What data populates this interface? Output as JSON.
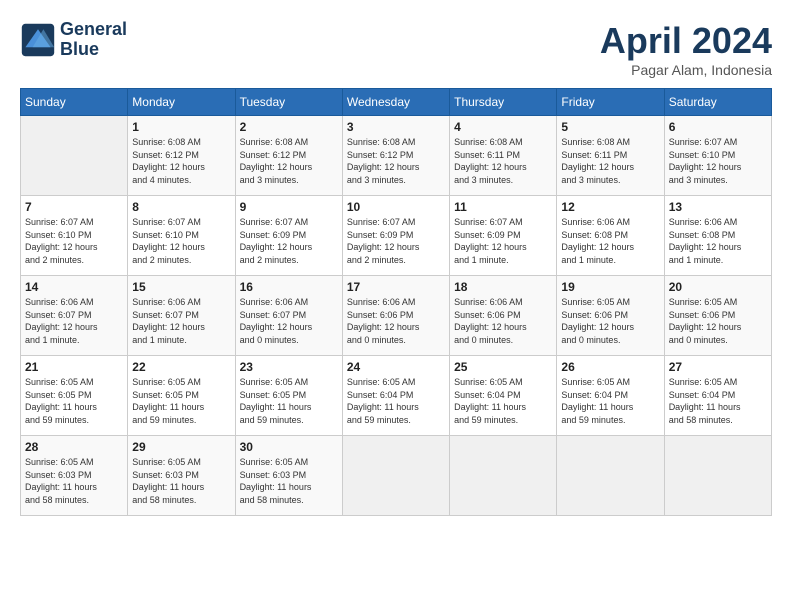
{
  "header": {
    "logo_line1": "General",
    "logo_line2": "Blue",
    "title": "April 2024",
    "location": "Pagar Alam, Indonesia"
  },
  "columns": [
    "Sunday",
    "Monday",
    "Tuesday",
    "Wednesday",
    "Thursday",
    "Friday",
    "Saturday"
  ],
  "weeks": [
    [
      {
        "day": "",
        "info": ""
      },
      {
        "day": "1",
        "info": "Sunrise: 6:08 AM\nSunset: 6:12 PM\nDaylight: 12 hours\nand 4 minutes."
      },
      {
        "day": "2",
        "info": "Sunrise: 6:08 AM\nSunset: 6:12 PM\nDaylight: 12 hours\nand 3 minutes."
      },
      {
        "day": "3",
        "info": "Sunrise: 6:08 AM\nSunset: 6:12 PM\nDaylight: 12 hours\nand 3 minutes."
      },
      {
        "day": "4",
        "info": "Sunrise: 6:08 AM\nSunset: 6:11 PM\nDaylight: 12 hours\nand 3 minutes."
      },
      {
        "day": "5",
        "info": "Sunrise: 6:08 AM\nSunset: 6:11 PM\nDaylight: 12 hours\nand 3 minutes."
      },
      {
        "day": "6",
        "info": "Sunrise: 6:07 AM\nSunset: 6:10 PM\nDaylight: 12 hours\nand 3 minutes."
      }
    ],
    [
      {
        "day": "7",
        "info": "Sunrise: 6:07 AM\nSunset: 6:10 PM\nDaylight: 12 hours\nand 2 minutes."
      },
      {
        "day": "8",
        "info": "Sunrise: 6:07 AM\nSunset: 6:10 PM\nDaylight: 12 hours\nand 2 minutes."
      },
      {
        "day": "9",
        "info": "Sunrise: 6:07 AM\nSunset: 6:09 PM\nDaylight: 12 hours\nand 2 minutes."
      },
      {
        "day": "10",
        "info": "Sunrise: 6:07 AM\nSunset: 6:09 PM\nDaylight: 12 hours\nand 2 minutes."
      },
      {
        "day": "11",
        "info": "Sunrise: 6:07 AM\nSunset: 6:09 PM\nDaylight: 12 hours\nand 1 minute."
      },
      {
        "day": "12",
        "info": "Sunrise: 6:06 AM\nSunset: 6:08 PM\nDaylight: 12 hours\nand 1 minute."
      },
      {
        "day": "13",
        "info": "Sunrise: 6:06 AM\nSunset: 6:08 PM\nDaylight: 12 hours\nand 1 minute."
      }
    ],
    [
      {
        "day": "14",
        "info": "Sunrise: 6:06 AM\nSunset: 6:07 PM\nDaylight: 12 hours\nand 1 minute."
      },
      {
        "day": "15",
        "info": "Sunrise: 6:06 AM\nSunset: 6:07 PM\nDaylight: 12 hours\nand 1 minute."
      },
      {
        "day": "16",
        "info": "Sunrise: 6:06 AM\nSunset: 6:07 PM\nDaylight: 12 hours\nand 0 minutes."
      },
      {
        "day": "17",
        "info": "Sunrise: 6:06 AM\nSunset: 6:06 PM\nDaylight: 12 hours\nand 0 minutes."
      },
      {
        "day": "18",
        "info": "Sunrise: 6:06 AM\nSunset: 6:06 PM\nDaylight: 12 hours\nand 0 minutes."
      },
      {
        "day": "19",
        "info": "Sunrise: 6:05 AM\nSunset: 6:06 PM\nDaylight: 12 hours\nand 0 minutes."
      },
      {
        "day": "20",
        "info": "Sunrise: 6:05 AM\nSunset: 6:06 PM\nDaylight: 12 hours\nand 0 minutes."
      }
    ],
    [
      {
        "day": "21",
        "info": "Sunrise: 6:05 AM\nSunset: 6:05 PM\nDaylight: 11 hours\nand 59 minutes."
      },
      {
        "day": "22",
        "info": "Sunrise: 6:05 AM\nSunset: 6:05 PM\nDaylight: 11 hours\nand 59 minutes."
      },
      {
        "day": "23",
        "info": "Sunrise: 6:05 AM\nSunset: 6:05 PM\nDaylight: 11 hours\nand 59 minutes."
      },
      {
        "day": "24",
        "info": "Sunrise: 6:05 AM\nSunset: 6:04 PM\nDaylight: 11 hours\nand 59 minutes."
      },
      {
        "day": "25",
        "info": "Sunrise: 6:05 AM\nSunset: 6:04 PM\nDaylight: 11 hours\nand 59 minutes."
      },
      {
        "day": "26",
        "info": "Sunrise: 6:05 AM\nSunset: 6:04 PM\nDaylight: 11 hours\nand 59 minutes."
      },
      {
        "day": "27",
        "info": "Sunrise: 6:05 AM\nSunset: 6:04 PM\nDaylight: 11 hours\nand 58 minutes."
      }
    ],
    [
      {
        "day": "28",
        "info": "Sunrise: 6:05 AM\nSunset: 6:03 PM\nDaylight: 11 hours\nand 58 minutes."
      },
      {
        "day": "29",
        "info": "Sunrise: 6:05 AM\nSunset: 6:03 PM\nDaylight: 11 hours\nand 58 minutes."
      },
      {
        "day": "30",
        "info": "Sunrise: 6:05 AM\nSunset: 6:03 PM\nDaylight: 11 hours\nand 58 minutes."
      },
      {
        "day": "",
        "info": ""
      },
      {
        "day": "",
        "info": ""
      },
      {
        "day": "",
        "info": ""
      },
      {
        "day": "",
        "info": ""
      }
    ]
  ]
}
